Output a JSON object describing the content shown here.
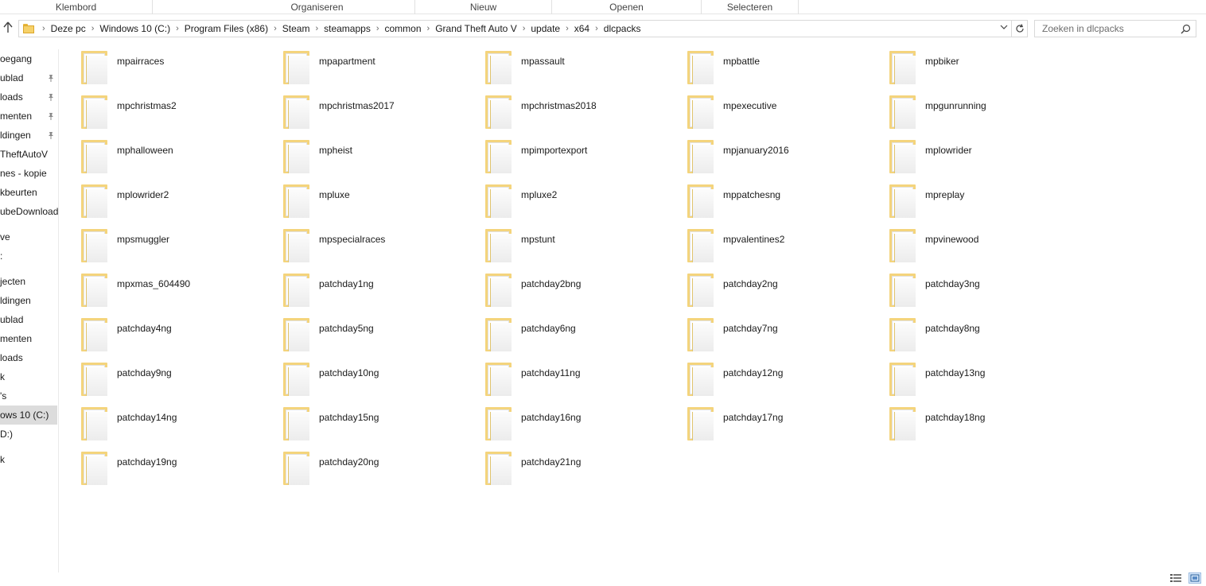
{
  "ribbon": {
    "groups": [
      "Klembord",
      "Organiseren",
      "Nieuw",
      "Openen",
      "Selecteren"
    ]
  },
  "address": {
    "crumbs": [
      "Deze pc",
      "Windows 10  (C:)",
      "Program Files (x86)",
      "Steam",
      "steamapps",
      "common",
      "Grand Theft Auto V",
      "update",
      "x64",
      "dlcpacks"
    ],
    "separator": "›",
    "dropdown_icon": "chevron-down-icon",
    "refresh_icon": "refresh-icon"
  },
  "search": {
    "placeholder": "Zoeken in dlcpacks"
  },
  "nav": {
    "items": [
      {
        "label": "oegang",
        "pinned": false
      },
      {
        "label": "ublad",
        "pinned": true
      },
      {
        "label": "loads",
        "pinned": true
      },
      {
        "label": "menten",
        "pinned": true
      },
      {
        "label": "ldingen",
        "pinned": true
      },
      {
        "label": "TheftAutoV",
        "pinned": false
      },
      {
        "label": "nes - kopie",
        "pinned": false
      },
      {
        "label": "kbeurten",
        "pinned": false
      },
      {
        "label": "ubeDownloads",
        "pinned": false
      },
      {
        "label": "ve",
        "pinned": false
      },
      {
        "label": ":",
        "pinned": false
      },
      {
        "label": "jecten",
        "pinned": false
      },
      {
        "label": "ldingen",
        "pinned": false
      },
      {
        "label": "ublad",
        "pinned": false
      },
      {
        "label": "menten",
        "pinned": false
      },
      {
        "label": "loads",
        "pinned": false
      },
      {
        "label": "k",
        "pinned": false
      },
      {
        "label": "'s",
        "pinned": false
      },
      {
        "label": "ows 10  (C:)",
        "pinned": false,
        "selected": true
      },
      {
        "label": "D:)",
        "pinned": false
      },
      {
        "label": "k",
        "pinned": false
      }
    ]
  },
  "folders": [
    "mpairraces",
    "mpapartment",
    "mpassault",
    "mpbattle",
    "mpbiker",
    "mpchristmas2",
    "mpchristmas2017",
    "mpchristmas2018",
    "mpexecutive",
    "mpgunrunning",
    "mphalloween",
    "mpheist",
    "mpimportexport",
    "mpjanuary2016",
    "mplowrider",
    "mplowrider2",
    "mpluxe",
    "mpluxe2",
    "mppatchesng",
    "mpreplay",
    "mpsmuggler",
    "mpspecialraces",
    "mpstunt",
    "mpvalentines2",
    "mpvinewood",
    "mpxmas_604490",
    "patchday1ng",
    "patchday2bng",
    "patchday2ng",
    "patchday3ng",
    "patchday4ng",
    "patchday5ng",
    "patchday6ng",
    "patchday7ng",
    "patchday8ng",
    "patchday9ng",
    "patchday10ng",
    "patchday11ng",
    "patchday12ng",
    "patchday13ng",
    "patchday14ng",
    "patchday15ng",
    "patchday16ng",
    "patchday17ng",
    "patchday18ng",
    "patchday19ng",
    "patchday20ng",
    "patchday21ng"
  ],
  "statusbar": {
    "view_icons": [
      "details-view-icon",
      "large-icons-view-icon"
    ]
  },
  "colors": {
    "folder": "#f4d47c",
    "selection": "#dcdcdc"
  }
}
